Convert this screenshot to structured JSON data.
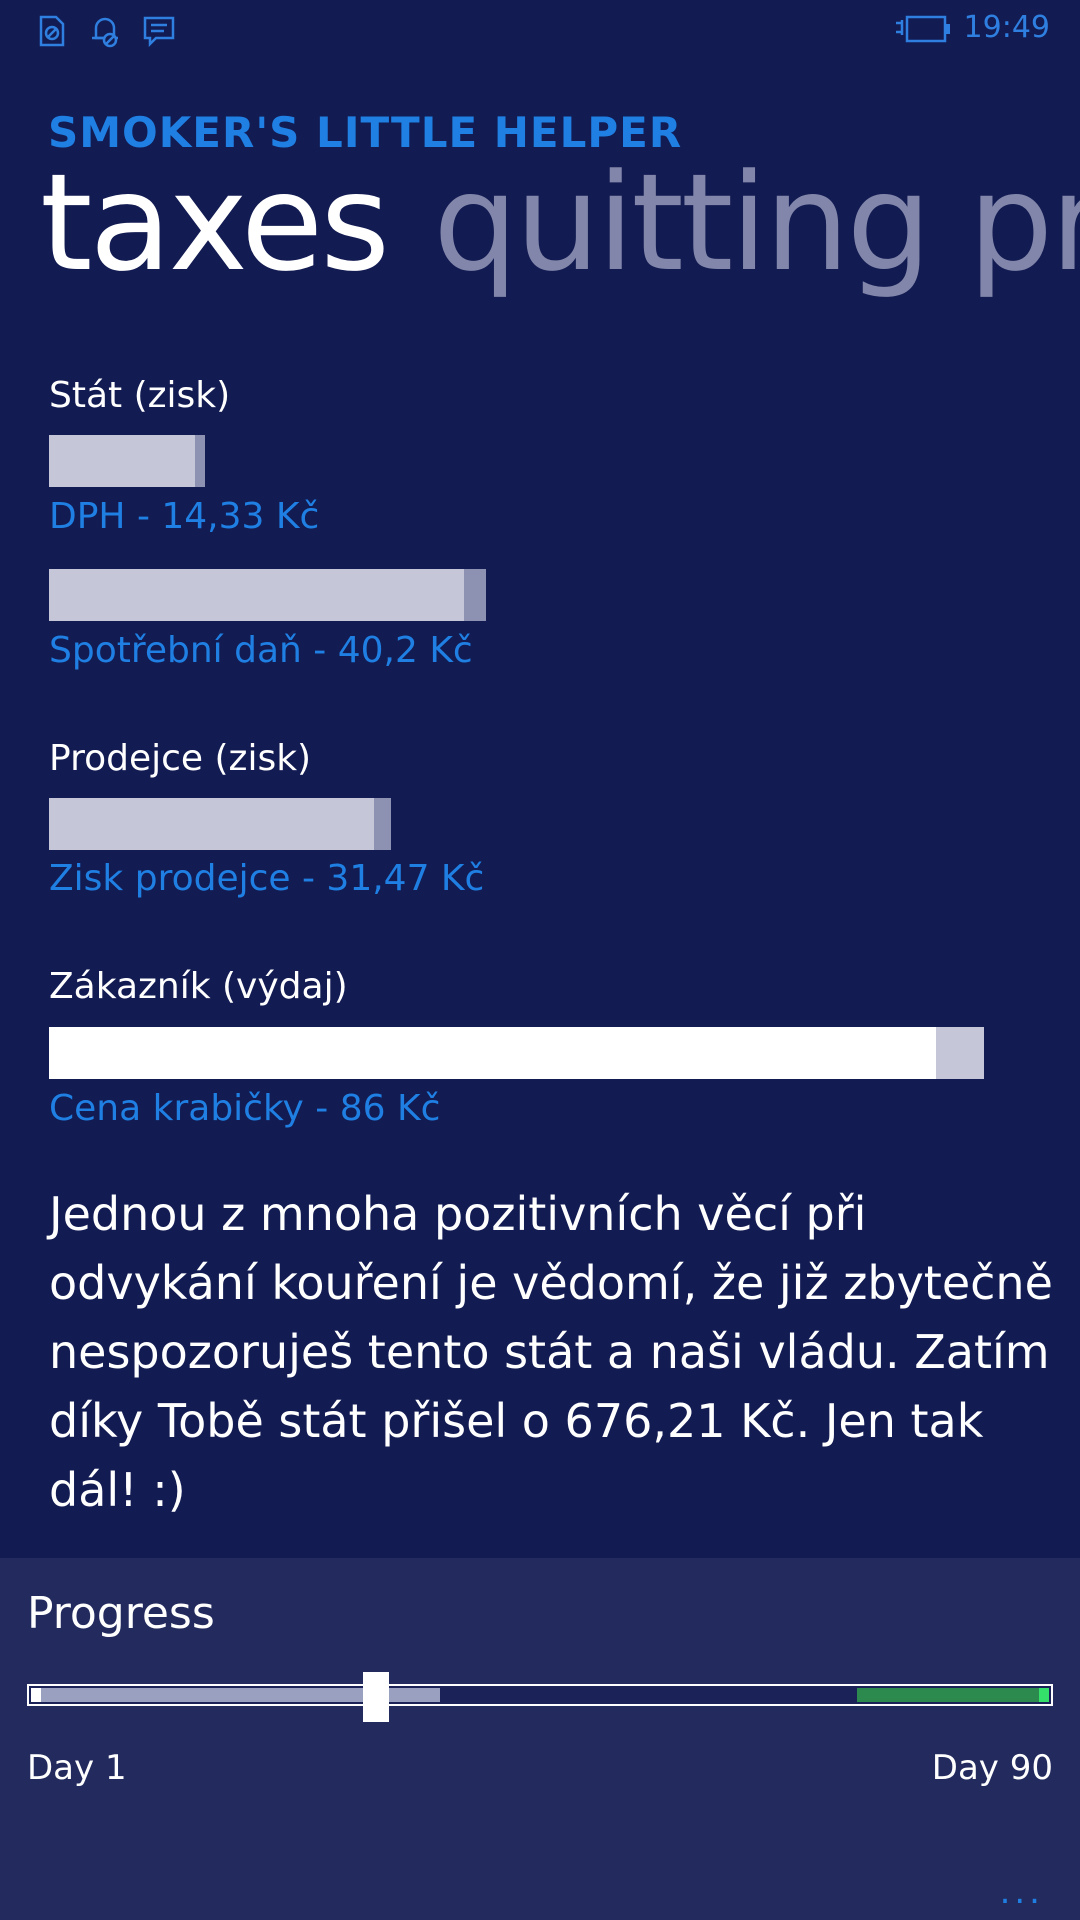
{
  "status_bar": {
    "time": "19:49",
    "icons": [
      "notification-sim-icon",
      "notification-quiet-icon",
      "message-icon"
    ],
    "battery": "battery-charging-icon"
  },
  "header": {
    "app_title": "SMOKER'S LITTLE HELPER",
    "active_pivot": "taxes",
    "next_pivot": "quitting proc"
  },
  "sections": [
    {
      "label": "Stát (zisk)",
      "bars": [
        {
          "caption": "DPH - 14,33 Kč",
          "value": 14.33
        },
        {
          "caption": "Spotřební daň - 40,2 Kč",
          "value": 40.2
        }
      ]
    },
    {
      "label": "Prodejce (zisk)",
      "bars": [
        {
          "caption": "Zisk prodejce - 31,47 Kč",
          "value": 31.47
        }
      ]
    },
    {
      "label": "Zákazník (výdaj)",
      "bars": [
        {
          "caption": "Cena krabičky - 86 Kč",
          "value": 86
        }
      ]
    }
  ],
  "message": "Jednou z mnoha pozitivních věcí při odvykání kouření je vědomí, že již zbytečně nespozoruješ tento stát a naši vládu. Zatím díky Tobě stát přišel o 676,21 Kč. Jen tak dál! :)",
  "progress": {
    "title": "Progress",
    "start_label": "Day 1",
    "end_label": "Day 90",
    "current_fraction": 0.34,
    "passed_fraction": 0.4,
    "green_start_fraction": 0.81
  },
  "app_bar": {
    "more_label": "..."
  },
  "colors": {
    "background": "#121b52",
    "accent": "#1f7fe3",
    "bottom_panel": "#222a5e",
    "bar_light": "#c5c7d9",
    "bar_edge": "#8d91b2",
    "bar_customer": "#ffffff",
    "progress_green": "#2d8a4e"
  }
}
